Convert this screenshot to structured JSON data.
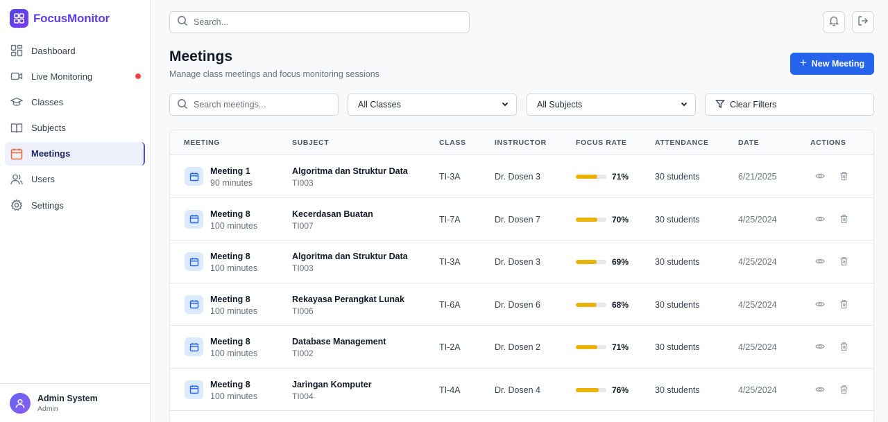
{
  "app": {
    "name": "FocusMonitor"
  },
  "sidebar": {
    "items": [
      {
        "label": "Dashboard",
        "icon": "dashboard-icon"
      },
      {
        "label": "Live Monitoring",
        "icon": "video-icon",
        "badge": "live-dot"
      },
      {
        "label": "Classes",
        "icon": "graduation-cap-icon"
      },
      {
        "label": "Subjects",
        "icon": "book-icon"
      },
      {
        "label": "Meetings",
        "icon": "calendar-icon",
        "active": true
      },
      {
        "label": "Users",
        "icon": "users-icon"
      },
      {
        "label": "Settings",
        "icon": "gear-icon"
      }
    ],
    "user": {
      "name": "Admin System",
      "role": "Admin"
    }
  },
  "topbar": {
    "search_placeholder": "Search..."
  },
  "header": {
    "title": "Meetings",
    "subtitle": "Manage class meetings and focus monitoring sessions",
    "new_button": "New Meeting"
  },
  "filters": {
    "search_placeholder": "Search meetings...",
    "class_selected": "All Classes",
    "subject_selected": "All Subjects",
    "clear_label": "Clear Filters"
  },
  "table": {
    "columns": [
      "MEETING",
      "SUBJECT",
      "CLASS",
      "INSTRUCTOR",
      "FOCUS RATE",
      "ATTENDANCE",
      "DATE",
      "ACTIONS"
    ],
    "rows": [
      {
        "meeting": "Meeting 1",
        "duration": "90 minutes",
        "subject": "Algoritma dan Struktur Data",
        "code": "TI003",
        "class": "TI-3A",
        "instructor": "Dr. Dosen 3",
        "focus": "71%",
        "focus_value": 71,
        "attendance": "30 students",
        "date": "6/21/2025"
      },
      {
        "meeting": "Meeting 8",
        "duration": "100 minutes",
        "subject": "Kecerdasan Buatan",
        "code": "TI007",
        "class": "TI-7A",
        "instructor": "Dr. Dosen 7",
        "focus": "70%",
        "focus_value": 70,
        "attendance": "30 students",
        "date": "4/25/2024"
      },
      {
        "meeting": "Meeting 8",
        "duration": "100 minutes",
        "subject": "Algoritma dan Struktur Data",
        "code": "TI003",
        "class": "TI-3A",
        "instructor": "Dr. Dosen 3",
        "focus": "69%",
        "focus_value": 69,
        "attendance": "30 students",
        "date": "4/25/2024"
      },
      {
        "meeting": "Meeting 8",
        "duration": "100 minutes",
        "subject": "Rekayasa Perangkat Lunak",
        "code": "TI006",
        "class": "TI-6A",
        "instructor": "Dr. Dosen 6",
        "focus": "68%",
        "focus_value": 68,
        "attendance": "30 students",
        "date": "4/25/2024"
      },
      {
        "meeting": "Meeting 8",
        "duration": "100 minutes",
        "subject": "Database Management",
        "code": "TI002",
        "class": "TI-2A",
        "instructor": "Dr. Dosen 2",
        "focus": "71%",
        "focus_value": 71,
        "attendance": "30 students",
        "date": "4/25/2024"
      },
      {
        "meeting": "Meeting 8",
        "duration": "100 minutes",
        "subject": "Jaringan Komputer",
        "code": "TI004",
        "class": "TI-4A",
        "instructor": "Dr. Dosen 4",
        "focus": "76%",
        "focus_value": 76,
        "attendance": "30 students",
        "date": "4/25/2024"
      }
    ]
  },
  "colors": {
    "primary": "#2563eb",
    "brand": "#5b3fe0",
    "focus_bar": "#eab308",
    "live": "#ef4444"
  }
}
